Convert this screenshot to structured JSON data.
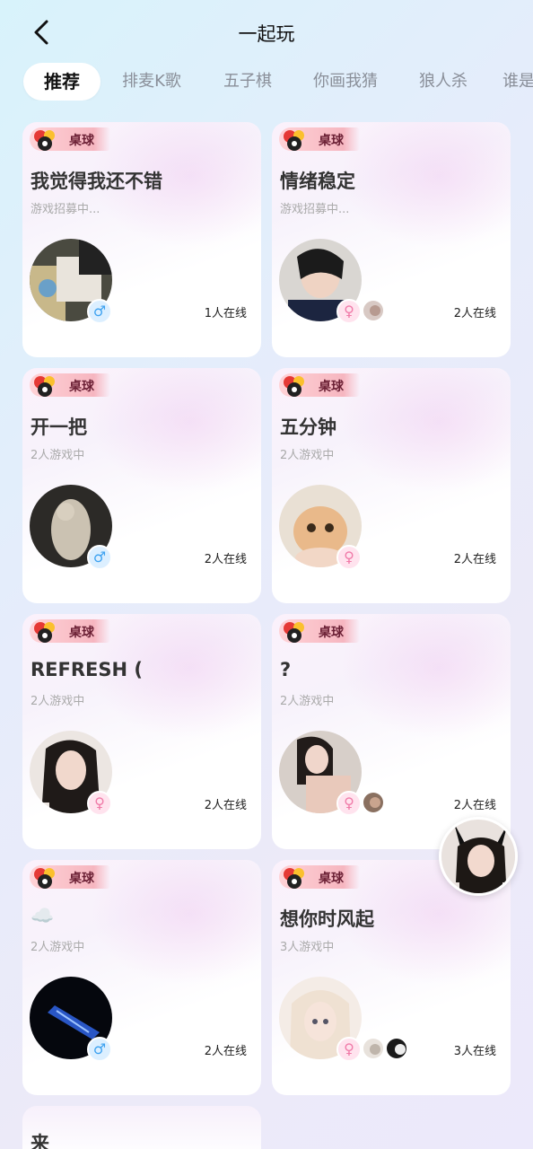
{
  "header": {
    "title": "一起玩"
  },
  "tabs": [
    {
      "label": "推荐",
      "active": true
    },
    {
      "label": "排麦K歌",
      "active": false
    },
    {
      "label": "五子棋",
      "active": false
    },
    {
      "label": "你画我猜",
      "active": false
    },
    {
      "label": "狼人杀",
      "active": false
    },
    {
      "label": "谁是",
      "active": false
    }
  ],
  "rooms": [
    {
      "game": "桌球",
      "title": "我觉得我还不错",
      "status": "游戏招募中...",
      "gender": "male",
      "gender_symbol": "♂",
      "online": "1人在线",
      "extra_avatars": 0
    },
    {
      "game": "桌球",
      "title": "情绪稳定",
      "status": "游戏招募中...",
      "gender": "female",
      "gender_symbol": "♀",
      "online": "2人在线",
      "extra_avatars": 1
    },
    {
      "game": "桌球",
      "title": "开一把",
      "status": "2人游戏中",
      "gender": "male",
      "gender_symbol": "♂",
      "online": "2人在线",
      "extra_avatars": 0
    },
    {
      "game": "桌球",
      "title": "五分钟",
      "status": "2人游戏中",
      "gender": "female",
      "gender_symbol": "♀",
      "online": "2人在线",
      "extra_avatars": 0
    },
    {
      "game": "桌球",
      "title": "REFRESH (",
      "status": "2人游戏中",
      "gender": "female",
      "gender_symbol": "♀",
      "online": "2人在线",
      "extra_avatars": 0
    },
    {
      "game": "桌球",
      "title": "?",
      "status": "2人游戏中",
      "gender": "female",
      "gender_symbol": "♀",
      "online": "2人在线",
      "extra_avatars": 1
    },
    {
      "game": "桌球",
      "title": "☁️",
      "status": "2人游戏中",
      "gender": "male",
      "gender_symbol": "♂",
      "online": "2人在线",
      "extra_avatars": 0
    },
    {
      "game": "桌球",
      "title": "想你时风起",
      "status": "3人游戏中",
      "gender": "female",
      "gender_symbol": "♀",
      "online": "3人在线",
      "extra_avatars": 2
    }
  ],
  "partial_room": {
    "title": "来"
  },
  "colors": {
    "male": "#3ea2f0",
    "female": "#f07aa8",
    "badge": "#f6b6c0"
  }
}
